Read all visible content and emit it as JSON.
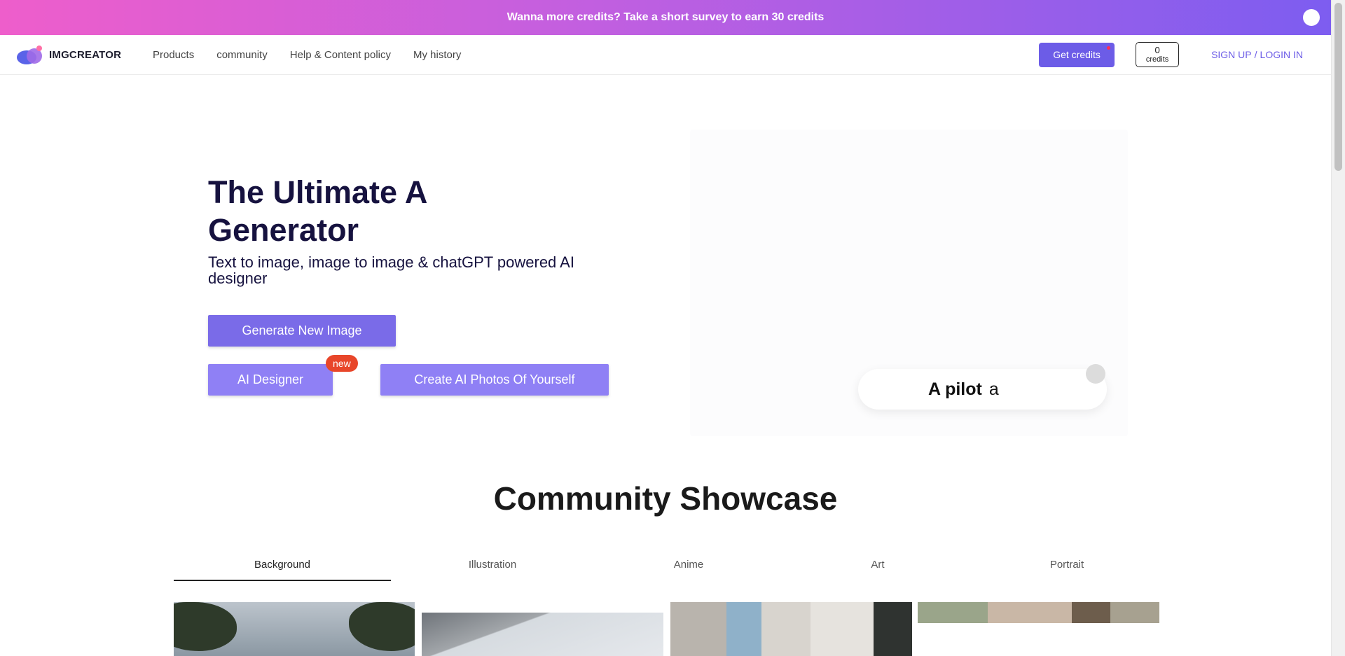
{
  "announcement": {
    "text": "Wanna more credits? Take a short survey to earn 30 credits"
  },
  "nav": {
    "logo_text": "IMGCREATOR",
    "links": [
      "Products",
      "community",
      "Help & Content policy",
      "My history"
    ],
    "get_credits_label": "Get credits",
    "credits_count": "0",
    "credits_label": "credits",
    "signup_label": "SIGN UP",
    "auth_separator": "/",
    "login_label": "LOGIN IN"
  },
  "hero": {
    "title": "The Ultimate A Generator",
    "subtitle": "Text to image, image to image & chatGPT powered AI designer",
    "generate_label": "Generate New Image",
    "designer_label": "AI Designer",
    "designer_badge": "new",
    "photos_label": "Create AI Photos Of Yourself",
    "prompt_text": "A pilot",
    "prompt_typing": "a"
  },
  "showcase": {
    "title": "Community Showcase",
    "tabs": [
      "Background",
      "Illustration",
      "Anime",
      "Art",
      "Portrait"
    ],
    "active_tab": "Background"
  },
  "colors": {
    "accent": "#6c5ce7",
    "button_primary": "#7a6be8",
    "button_secondary": "#8f80f5",
    "badge": "#e8462a",
    "heading": "#16123f"
  }
}
